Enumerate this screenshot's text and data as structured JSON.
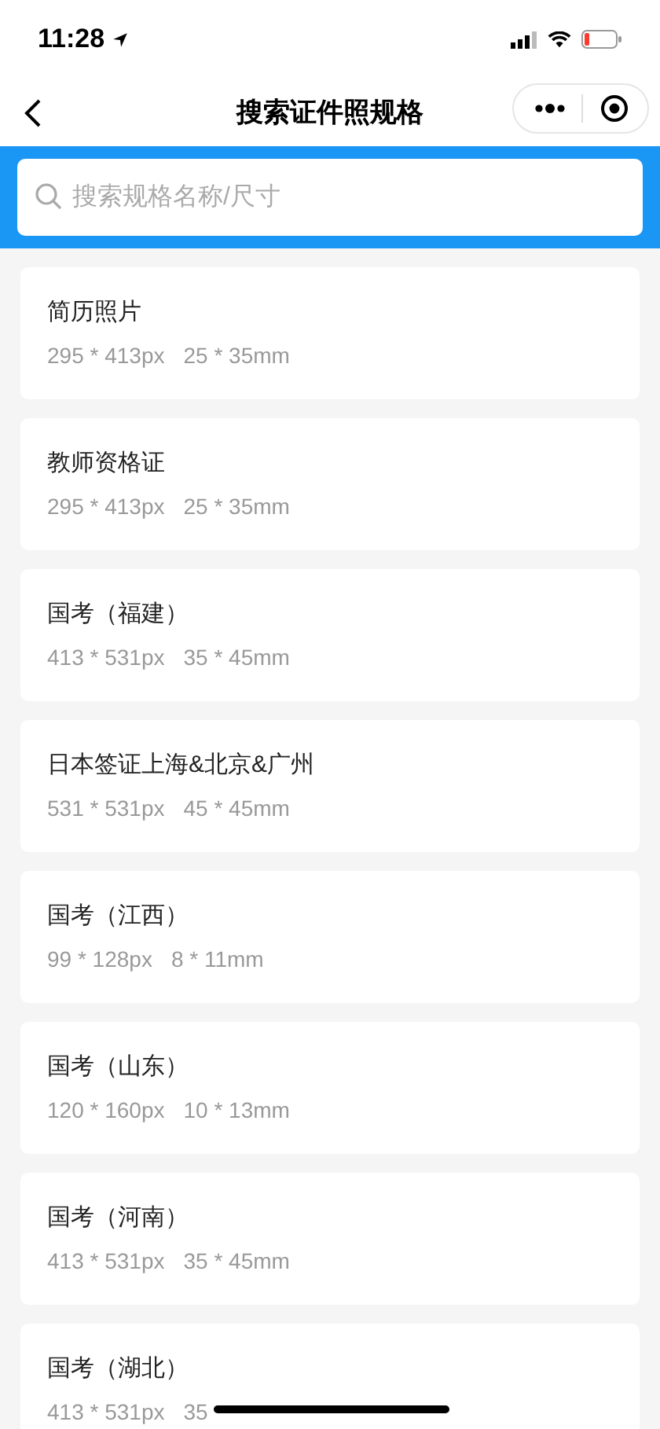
{
  "status_bar": {
    "time": "11:28"
  },
  "nav": {
    "title": "搜索证件照规格"
  },
  "search": {
    "placeholder": "搜索规格名称/尺寸"
  },
  "specs": [
    {
      "name": "简历照片",
      "pixels": "295 * 413px",
      "size": "25 * 35mm"
    },
    {
      "name": "教师资格证",
      "pixels": "295 * 413px",
      "size": "25 * 35mm"
    },
    {
      "name": "国考（福建）",
      "pixels": "413 * 531px",
      "size": "35 * 45mm"
    },
    {
      "name": "日本签证上海&北京&广州",
      "pixels": "531 * 531px",
      "size": "45 * 45mm"
    },
    {
      "name": "国考（江西）",
      "pixels": "99 * 128px",
      "size": "8 * 11mm"
    },
    {
      "name": "国考（山东）",
      "pixels": "120 * 160px",
      "size": "10 * 13mm"
    },
    {
      "name": "国考（河南）",
      "pixels": "413 * 531px",
      "size": "35 * 45mm"
    },
    {
      "name": "国考（湖北）",
      "pixels": "413 * 531px",
      "size": "35"
    }
  ]
}
